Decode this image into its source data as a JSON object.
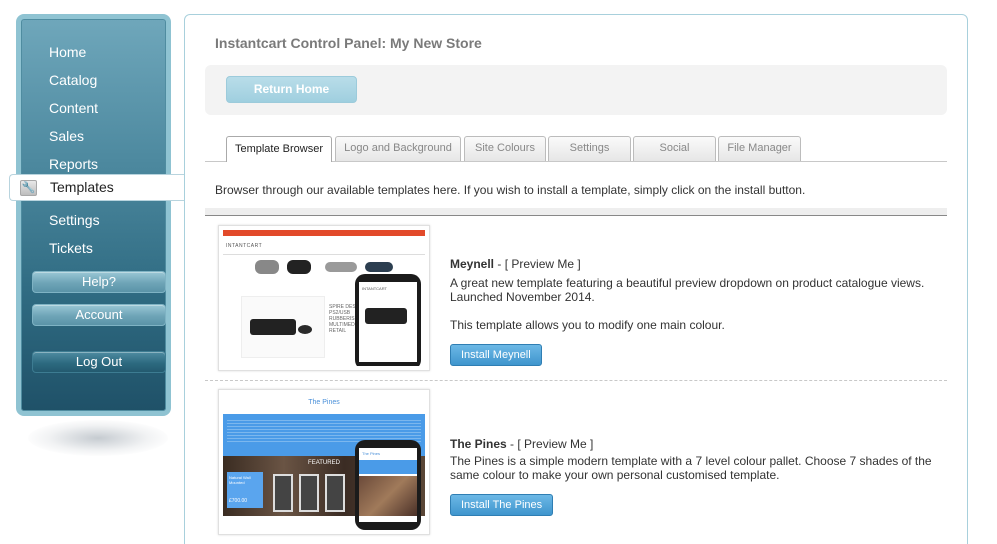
{
  "sidebar": {
    "items": [
      {
        "label": "Home"
      },
      {
        "label": "Catalog"
      },
      {
        "label": "Content"
      },
      {
        "label": "Sales"
      },
      {
        "label": "Reports"
      },
      {
        "label": "Templates",
        "active": true,
        "icon": "wrench-icon"
      },
      {
        "label": "Settings"
      },
      {
        "label": "Tickets"
      }
    ],
    "help_label": "Help?",
    "account_label": "Account",
    "logout_label": "Log Out"
  },
  "header": {
    "title": "Instantcart Control Panel: My New Store",
    "return_home_label": "Return Home"
  },
  "tabs": [
    {
      "label": "Template Browser",
      "active": true
    },
    {
      "label": "Logo and Background"
    },
    {
      "label": "Site Colours"
    },
    {
      "label": "Settings"
    },
    {
      "label": "Social"
    },
    {
      "label": "File Manager"
    }
  ],
  "intro": "Browser through our available templates here. If you wish to install a template, simply click on the install button.",
  "templates": [
    {
      "name": "Meynell",
      "preview_label": "[ Preview Me ]",
      "description": "A great new template featuring a beautiful preview dropdown on product catalogue views. Launched November 2014.",
      "note": "This template allows you to modify one main colour.",
      "install_label": "Install Meynell",
      "thumb_brand": "INTANTCART",
      "thumb_phone_brand": "INTANTCART",
      "thumb_text": "SPIRE DESK\nPS2/USB\nRUBBERIS\nMULTIMED\nRETAIL"
    },
    {
      "name": "The Pines",
      "preview_label": "[ Preview Me ]",
      "description": "The Pines is a simple modern template with a 7 level colour pallet. Choose 7 shades of the same colour to make your own personal customised template.",
      "install_label": "Install The Pines",
      "thumb_title": "The Pines",
      "thumb_featured": "FEATURED",
      "thumb_card_title": "Natural Wall Mounted",
      "thumb_card_price": "£700.00",
      "thumb_phone_title": "The Pines"
    }
  ],
  "colors": {
    "accent": "#3f95cd",
    "sidebar": "#2f6b82",
    "return_home": "#9fcfdf"
  }
}
